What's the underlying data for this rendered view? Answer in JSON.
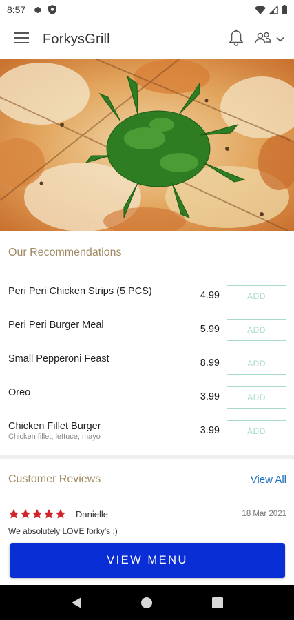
{
  "status_bar": {
    "time": "8:57"
  },
  "app_bar": {
    "title": "ForkysGrill"
  },
  "recommendations": {
    "title": "Our Recommendations",
    "items": [
      {
        "name": "Peri Peri Chicken Strips (5 PCS)",
        "description": "",
        "price": "4.99",
        "button": "ADD"
      },
      {
        "name": "Peri Peri Burger Meal",
        "description": "",
        "price": "5.99",
        "button": "ADD"
      },
      {
        "name": "Small Pepperoni Feast",
        "description": "",
        "price": "8.99",
        "button": "ADD"
      },
      {
        "name": "Oreo",
        "description": "",
        "price": "3.99",
        "button": "ADD"
      },
      {
        "name": "Chicken Fillet Burger",
        "description": "Chicken fillet, lettuce, mayo",
        "price": "3.99",
        "button": "ADD"
      }
    ]
  },
  "reviews": {
    "title": "Customer Reviews",
    "view_all": "View All",
    "items": [
      {
        "name": "Danielle",
        "date": "18 Mar 2021",
        "rating": 5,
        "text": "We absolutely LOVE forky's :)"
      }
    ]
  },
  "cta": {
    "label": "VIEW MENU"
  },
  "colors": {
    "accent_gold": "#a08a63",
    "add_green": "#a9dcc7",
    "cta_blue": "#0a2ed6",
    "link_blue": "#1e6fc0",
    "star_red": "#d3232a"
  },
  "icons": [
    "settings-icon",
    "shield-icon",
    "wifi-icon",
    "signal-icon",
    "battery-icon",
    "menu-icon",
    "bell-icon",
    "account-icon",
    "chevron-down-icon",
    "star-icon",
    "back-icon",
    "home-icon",
    "recents-icon"
  ]
}
